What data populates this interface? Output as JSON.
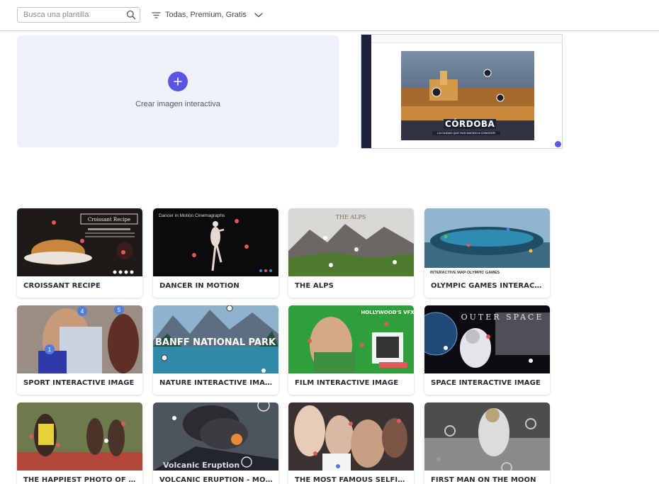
{
  "search": {
    "placeholder": "Busca una plantilla"
  },
  "filter": {
    "label": "Todas, Premium, Gratis"
  },
  "create": {
    "label": "Crear imagen interactiva"
  },
  "preview": {
    "title": "CÓRDOBA",
    "subtitle": "LA CIUDAD QUE HAS NACIDO A CONOCER"
  },
  "templates": [
    {
      "title": "CROISSANT RECIPE",
      "thumb_text": "Croissant Recipe"
    },
    {
      "title": "DANCER IN MOTION",
      "thumb_text": "Dancer in Motion Cinemagraphs"
    },
    {
      "title": "THE ALPS",
      "thumb_text": "THE ALPS"
    },
    {
      "title": "OLYMPIC GAMES INTERACTIVE ...",
      "thumb_text": "INTERACTIVE MAP OLYMPIC GAMES"
    },
    {
      "title": "SPORT INTERACTIVE IMAGE",
      "thumb_text": ""
    },
    {
      "title": "NATURE INTERACTIVE IMAGE",
      "thumb_text": "BANFF NATIONAL PARK"
    },
    {
      "title": "FILM INTERACTIVE IMAGE",
      "thumb_text": "HOLLYWOOD'S VFX"
    },
    {
      "title": "SPACE INTERACTIVE IMAGE",
      "thumb_text": "OUTER SPACE"
    },
    {
      "title": "THE HAPPIEST PHOTO OF USA...",
      "thumb_text": ""
    },
    {
      "title": "VOLCANIC ERUPTION - MOUNT...",
      "thumb_text": "Volcanic Eruption"
    },
    {
      "title": "THE MOST FAMOUS SELFIE IN ...",
      "thumb_text": ""
    },
    {
      "title": "FIRST MAN ON THE MOON",
      "thumb_text": ""
    }
  ],
  "colors": {
    "accent": "#5b55e6",
    "create_bg": "#eef0fa",
    "divider": "#c9c9cf"
  }
}
